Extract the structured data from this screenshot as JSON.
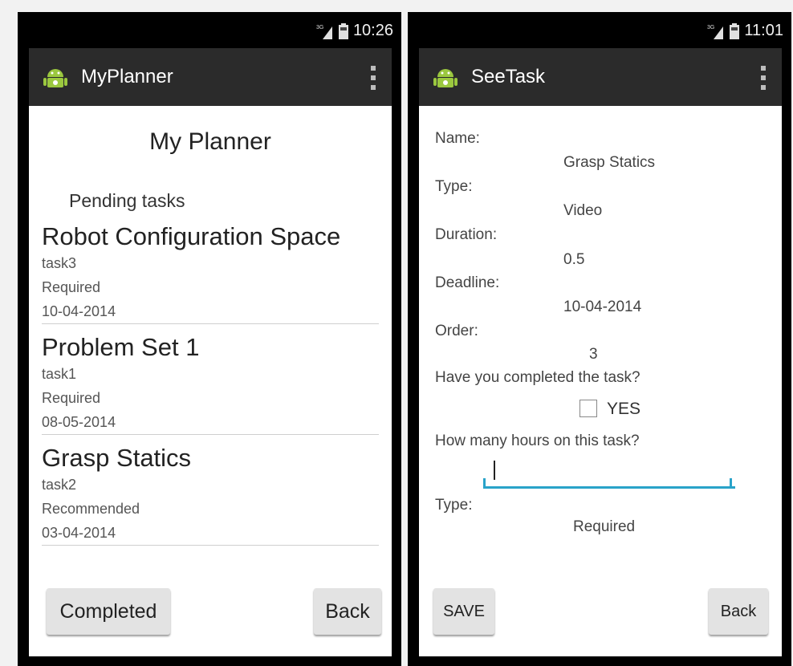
{
  "left": {
    "status": {
      "network": "3G",
      "time": "10:26"
    },
    "actionbar": {
      "title": "MyPlanner"
    },
    "heading": "My Planner",
    "section_label": "Pending tasks",
    "tasks": [
      {
        "title": "Robot Configuration Space",
        "id": "task3",
        "kind": "Required",
        "date": "10-04-2014"
      },
      {
        "title": "Problem Set 1",
        "id": "task1",
        "kind": "Required",
        "date": "08-05-2014"
      },
      {
        "title": "Grasp Statics",
        "id": "task2",
        "kind": "Recommended",
        "date": "03-04-2014"
      }
    ],
    "buttons": {
      "completed": "Completed",
      "back": "Back"
    }
  },
  "right": {
    "status": {
      "network": "3G",
      "time": "11:01"
    },
    "actionbar": {
      "title": "SeeTask"
    },
    "fields": {
      "name_label": "Name:",
      "name_value": "Grasp Statics",
      "type_label": "Type:",
      "type_value": "Video",
      "duration_label": "Duration:",
      "duration_value": "0.5",
      "deadline_label": "Deadline:",
      "deadline_value": "10-04-2014",
      "order_label": "Order:",
      "order_value": "3",
      "completed_question": "Have you completed the task?",
      "checkbox_label": "YES",
      "checkbox_checked": false,
      "hours_question": "How many hours on this task?",
      "hours_value": "",
      "type2_label": "Type:",
      "type2_value": "Required"
    },
    "buttons": {
      "save": "SAVE",
      "back": "Back"
    }
  },
  "colors": {
    "input_underline": "#29a3c9",
    "actionbar": "#2b2b2b",
    "android_green": "#9bc83f"
  }
}
